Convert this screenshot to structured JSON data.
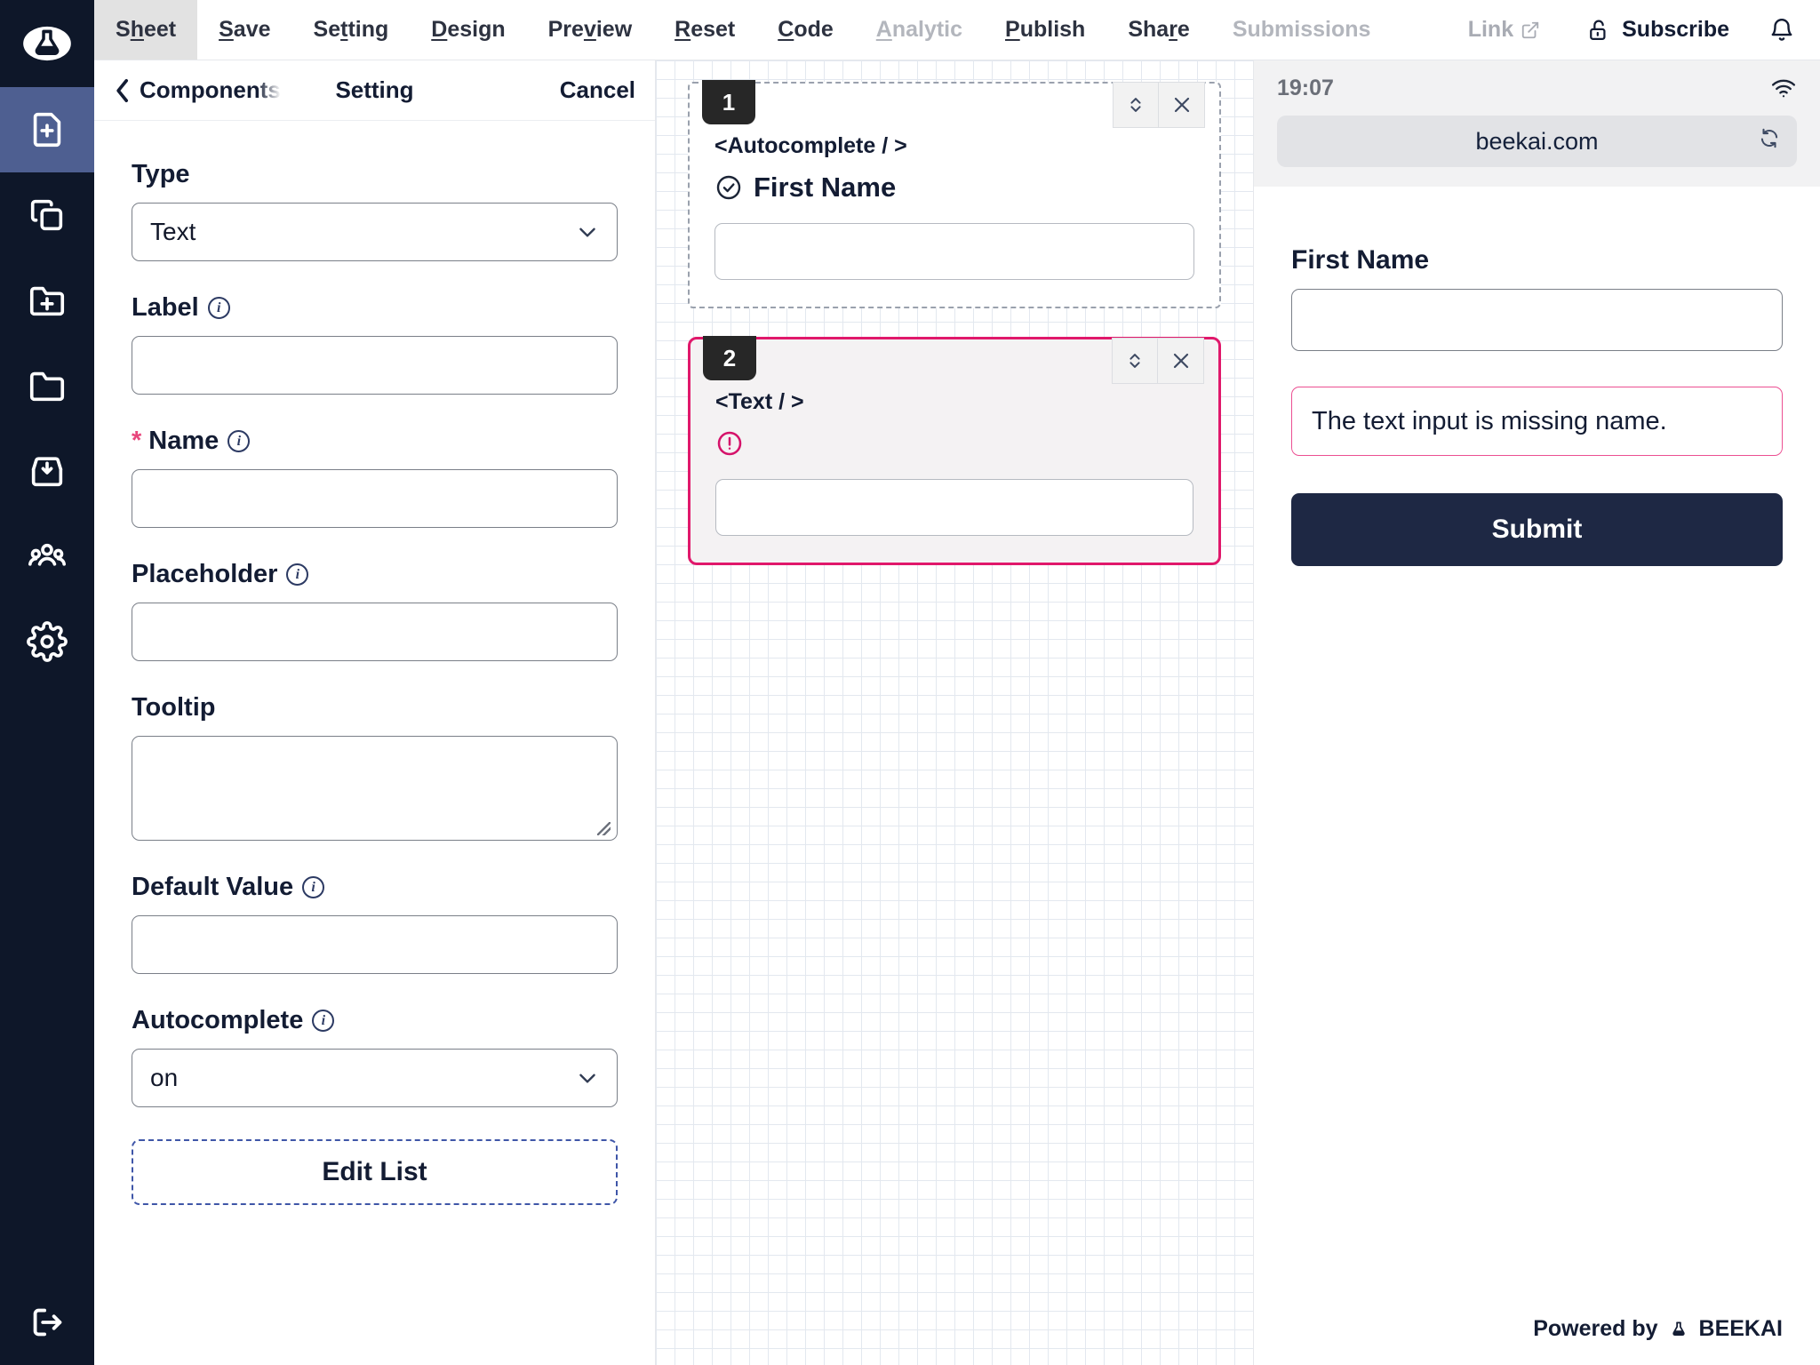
{
  "rail": {
    "logo": "flask-logo",
    "items": [
      {
        "icon": "new-file-icon",
        "name": "new-file",
        "active": true
      },
      {
        "icon": "copy-icon",
        "name": "duplicate",
        "active": false
      },
      {
        "icon": "new-folder-icon",
        "name": "new-folder",
        "active": false
      },
      {
        "icon": "folder-icon",
        "name": "folder",
        "active": false
      },
      {
        "icon": "inbox-download-icon",
        "name": "inbox",
        "active": false
      },
      {
        "icon": "users-icon",
        "name": "team",
        "active": false
      },
      {
        "icon": "gear-icon",
        "name": "settings",
        "active": false
      }
    ],
    "logout": "logout-icon"
  },
  "menubar": {
    "items": [
      {
        "label": "Sheet",
        "accel": "h",
        "active": true,
        "disabled": false
      },
      {
        "label": "Save",
        "accel": "S",
        "active": false,
        "disabled": false
      },
      {
        "label": "Setting",
        "accel": "t",
        "active": false,
        "disabled": false
      },
      {
        "label": "Design",
        "accel": "D",
        "active": false,
        "disabled": false
      },
      {
        "label": "Preview",
        "accel": "v",
        "active": false,
        "disabled": false
      },
      {
        "label": "Reset",
        "accel": "R",
        "active": false,
        "disabled": false
      },
      {
        "label": "Code",
        "accel": "C",
        "active": false,
        "disabled": false
      },
      {
        "label": "Analytic",
        "accel": "A",
        "active": false,
        "disabled": true
      },
      {
        "label": "Publish",
        "accel": "P",
        "active": false,
        "disabled": false
      },
      {
        "label": "Share",
        "accel": "r",
        "active": false,
        "disabled": false
      },
      {
        "label": "Submissions",
        "accel": "",
        "active": false,
        "disabled": true
      }
    ],
    "link_label": "Link",
    "subscribe_label": "Subscribe",
    "notification_icon": "bell-icon",
    "link_icon": "external-link-icon",
    "lock_icon": "unlock-icon"
  },
  "panel": {
    "back_label": "Components",
    "title": "Setting",
    "cancel_label": "Cancel",
    "fields": [
      {
        "label": "Type",
        "info": false,
        "required": false,
        "kind": "select",
        "value": "Text"
      },
      {
        "label": "Label",
        "info": true,
        "required": false,
        "kind": "input",
        "value": ""
      },
      {
        "label": "Name",
        "info": true,
        "required": true,
        "kind": "input",
        "value": ""
      },
      {
        "label": "Placeholder",
        "info": true,
        "required": false,
        "kind": "input",
        "value": ""
      },
      {
        "label": "Tooltip",
        "info": false,
        "required": false,
        "kind": "textarea",
        "value": ""
      },
      {
        "label": "Default Value",
        "info": true,
        "required": false,
        "kind": "input",
        "value": ""
      },
      {
        "label": "Autocomplete",
        "info": true,
        "required": false,
        "kind": "select",
        "value": "on"
      }
    ],
    "edit_list_label": "Edit List"
  },
  "canvas": {
    "cards": [
      {
        "badge": "1",
        "tag": "<Autocomplete / >",
        "label": "First Name",
        "status_icon": "check-circle-icon",
        "selected": false,
        "value": ""
      },
      {
        "badge": "2",
        "tag": "<Text / >",
        "label": "",
        "status_icon": "alert-circle-icon",
        "selected": true,
        "value": ""
      }
    ],
    "tools": {
      "reorder_icon": "up-down-chevron-icon",
      "close_icon": "close-icon"
    }
  },
  "preview": {
    "time": "19:07",
    "wifi_icon": "wifi-icon",
    "url": "beekai.com",
    "refresh_icon": "refresh-icon",
    "field_label": "First Name",
    "field_value": "",
    "error_message": "The text input is missing name.",
    "submit_label": "Submit",
    "footer_text": "Powered by",
    "footer_brand": "BEEKAI",
    "footer_icon": "flask-logo"
  },
  "colors": {
    "rail_bg": "#0e1729",
    "rail_active": "#4e5f91",
    "accent_pink": "#e0186b",
    "error_pink": "#ec4f92",
    "required_star": "#e8467c",
    "submit_navy": "#1e2844",
    "grid_line": "#e3e8ef",
    "dashed_blue": "#3f56a8"
  }
}
